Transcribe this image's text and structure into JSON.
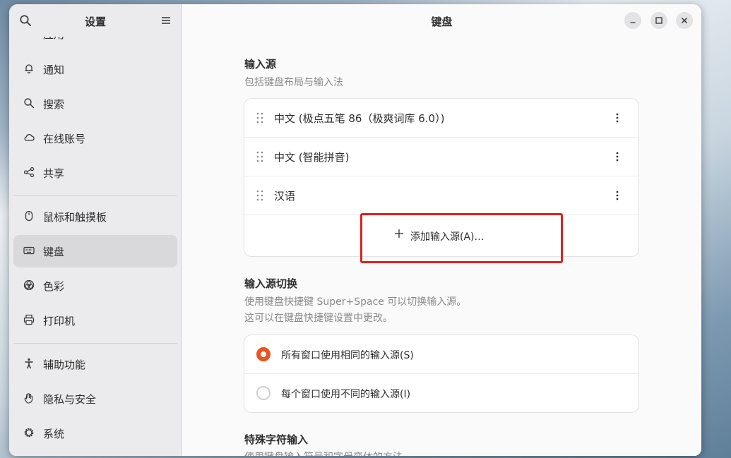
{
  "sidebar": {
    "title": "设置",
    "items": [
      {
        "label": "应用",
        "icon": "apps-icon"
      },
      {
        "label": "通知",
        "icon": "bell-icon"
      },
      {
        "label": "搜索",
        "icon": "search-icon"
      },
      {
        "label": "在线账号",
        "icon": "cloud-icon"
      },
      {
        "label": "共享",
        "icon": "share-icon"
      },
      {
        "label": "鼠标和触摸板",
        "icon": "mouse-icon"
      },
      {
        "label": "键盘",
        "icon": "keyboard-icon",
        "active": true
      },
      {
        "label": "色彩",
        "icon": "color-icon"
      },
      {
        "label": "打印机",
        "icon": "printer-icon"
      },
      {
        "label": "辅助功能",
        "icon": "accessibility-icon"
      },
      {
        "label": "隐私与安全",
        "icon": "hand-icon"
      },
      {
        "label": "系统",
        "icon": "gear-icon"
      }
    ]
  },
  "header": {
    "title": "键盘"
  },
  "input_sources": {
    "title": "输入源",
    "description": "包括键盘布局与输入法",
    "items": [
      {
        "label": "中文 (极点五笔 86（极爽词库 6.0）)"
      },
      {
        "label": "中文 (智能拼音)"
      },
      {
        "label": "汉语"
      }
    ],
    "add_label": "添加输入源(A)…"
  },
  "switching": {
    "title": "输入源切换",
    "description_line1": "使用键盘快捷键 Super+Space 可以切换输入源。",
    "description_line2": "这可以在键盘快捷键设置中更改。",
    "options": [
      {
        "label": "所有窗口使用相同的输入源(S)",
        "selected": true
      },
      {
        "label": "每个窗口使用不同的输入源(I)",
        "selected": false
      }
    ]
  },
  "special_chars": {
    "title": "特殊字符输入",
    "description": "使用键盘输入符号和字母变体的方法"
  },
  "colors": {
    "accent": "#e95420",
    "highlight_box": "#e0201e"
  }
}
